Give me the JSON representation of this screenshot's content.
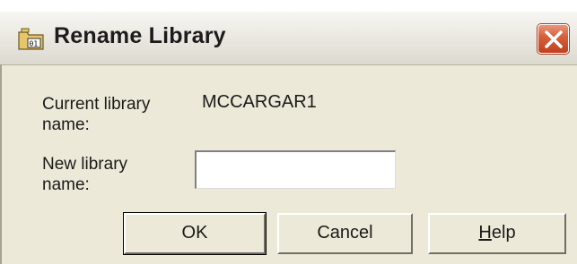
{
  "window": {
    "title": "Rename Library",
    "close_icon": "close-icon",
    "app_icon": "library-folder-icon"
  },
  "form": {
    "current_label": "Current library\nname:",
    "current_value": "MCCARGAR1",
    "new_label": "New library\nname:",
    "new_value": "",
    "new_placeholder": ""
  },
  "buttons": {
    "ok": "OK",
    "cancel": "Cancel",
    "help_mnemonic": "H",
    "help_rest": "elp"
  },
  "colors": {
    "close_button": "#d8613e",
    "dialog_background": "#ece9d8"
  }
}
